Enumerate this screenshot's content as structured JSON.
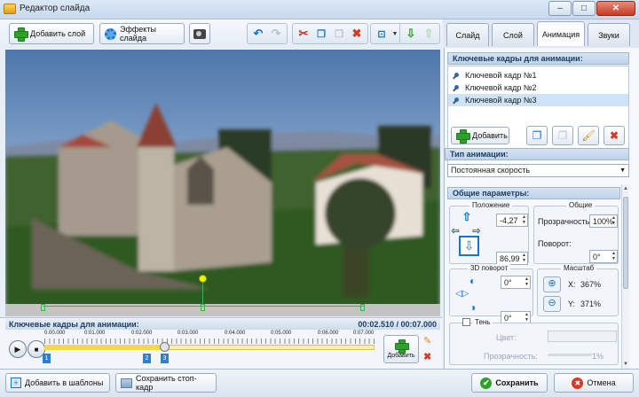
{
  "window": {
    "title": "Редактор слайда",
    "min_label": "–",
    "max_label": "□",
    "close_label": "✕"
  },
  "toolbar": {
    "add_layer": "Добавить слой",
    "slide_effects": "Эффекты слайда"
  },
  "tabs": [
    {
      "label": "Слайд"
    },
    {
      "label": "Слой"
    },
    {
      "label": "Анимация"
    },
    {
      "label": "Звуки"
    }
  ],
  "keyframes": {
    "header": "Ключевые кадры для анимации:",
    "items": [
      {
        "label": "Ключевой кадр №1"
      },
      {
        "label": "Ключевой кадр №2"
      },
      {
        "label": "Ключевой кадр №3"
      }
    ],
    "add_label": "Добавить"
  },
  "anim_type": {
    "header": "Тип анимации:",
    "value": "Постоянная скорость"
  },
  "params": {
    "header": "Общие параметры:",
    "position_title": "Положение",
    "pos_x": "-4,27",
    "pos_y": "86,99",
    "general_title": "Общие",
    "opacity_label": "Прозрачность:",
    "opacity_value": "100%",
    "rotate_label": "Поворот:",
    "rotate_value": "0°",
    "rot3d_title": "3D поворот",
    "rot3d_x": "0°",
    "rot3d_y": "0°",
    "scale_title": "Масштаб",
    "scale_x_label": "X:",
    "scale_x": "367%",
    "scale_y_label": "Y:",
    "scale_y": "371%",
    "shadow_label": "Тень",
    "color_label": "Цвет:",
    "shadow_opacity_label": "Прозрачность:",
    "shadow_opacity_value": "1%"
  },
  "timeline": {
    "header": "Ключевые кадры для анимации:",
    "time": "00:02.510 / 00:07.000",
    "ticks": [
      "0.00.000",
      "0:01.000",
      "0:02.000",
      "0:03.000",
      "0:04.000",
      "0:05.000",
      "0:06.000",
      "0:07.000"
    ],
    "markers": [
      "1",
      "2",
      "3"
    ],
    "add_label": "Добавить"
  },
  "footer": {
    "add_templates": "Добавить в шаблоны",
    "save_frame": "Сохранить стоп-кадр",
    "save": "Сохранить",
    "cancel": "Отмена"
  },
  "colors": {
    "accent": "#1a73c8",
    "selected": "#cfe3f7",
    "green": "#2fa12a",
    "red": "#d63b24"
  }
}
